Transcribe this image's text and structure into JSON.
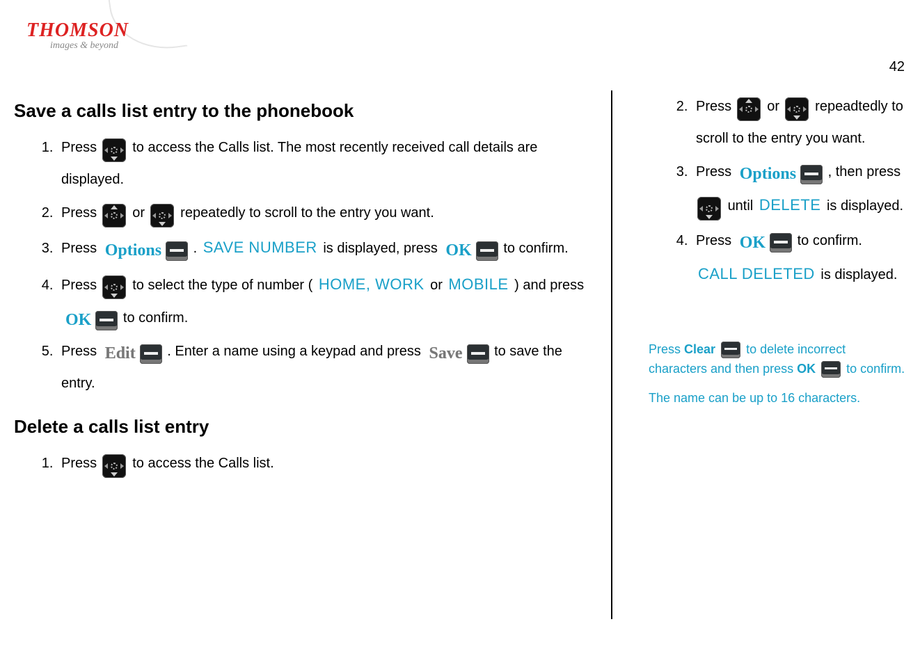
{
  "logo": {
    "brand": "THOMSON",
    "tagline": "images & beyond"
  },
  "page_number": "42",
  "left": {
    "section1_title": "Save a calls list entry to the phonebook",
    "s1_step1_a": "Press ",
    "s1_step1_b": " to access the Calls list.  The most recently received call details are displayed.",
    "s1_step2_a": "Press ",
    "s1_step2_or": " or ",
    "s1_step2_b": " repeatedly to scroll to the entry you want.",
    "s1_step3_a": "Press ",
    "s1_step3_b": ".  ",
    "s1_step3_disp": "SAVE NUMBER",
    "s1_step3_c": " is displayed, press ",
    "s1_step3_d": " to confirm.",
    "s1_step4_a": "Press ",
    "s1_step4_b": " to select the type of number (",
    "s1_step4_disp": "HOME, WORK",
    "s1_step4_or": " or ",
    "s1_step4_disp2": "MOBILE",
    "s1_step4_c": ") and press ",
    "s1_step4_d": " to confirm.",
    "s1_step5_a": "Press ",
    "s1_step5_b": ".  Enter a name using a keypad and press ",
    "s1_step5_c": " to save the entry.",
    "section2_title": "Delete a calls list entry",
    "s2_step1_a": "Press ",
    "s2_step1_b": " to access the Calls list.",
    "soft_options": "Options",
    "soft_ok": "OK",
    "soft_edit": "Edit",
    "soft_save": "Save"
  },
  "right": {
    "step2_a": "Press ",
    "step2_or": " or ",
    "step2_b": " repeadtedly to scroll to the entry you want.",
    "step3_a": "Press ",
    "step3_b": ", then press ",
    "step3_c": " until ",
    "step3_disp": "DELETE",
    "step3_d": " is displayed.",
    "step4_a": "Press ",
    "step4_b": " to confirm.  ",
    "step4_disp": "CALL DELETED",
    "step4_c": " is displayed.",
    "soft_options": "Options",
    "soft_ok": "OK",
    "tip_a": "Press ",
    "tip_clear": "Clear",
    "tip_b": " to delete incorrect characters and then press ",
    "tip_ok": "OK",
    "tip_c": " to confirm.",
    "tip2": "The name can be up to 16 characters."
  }
}
